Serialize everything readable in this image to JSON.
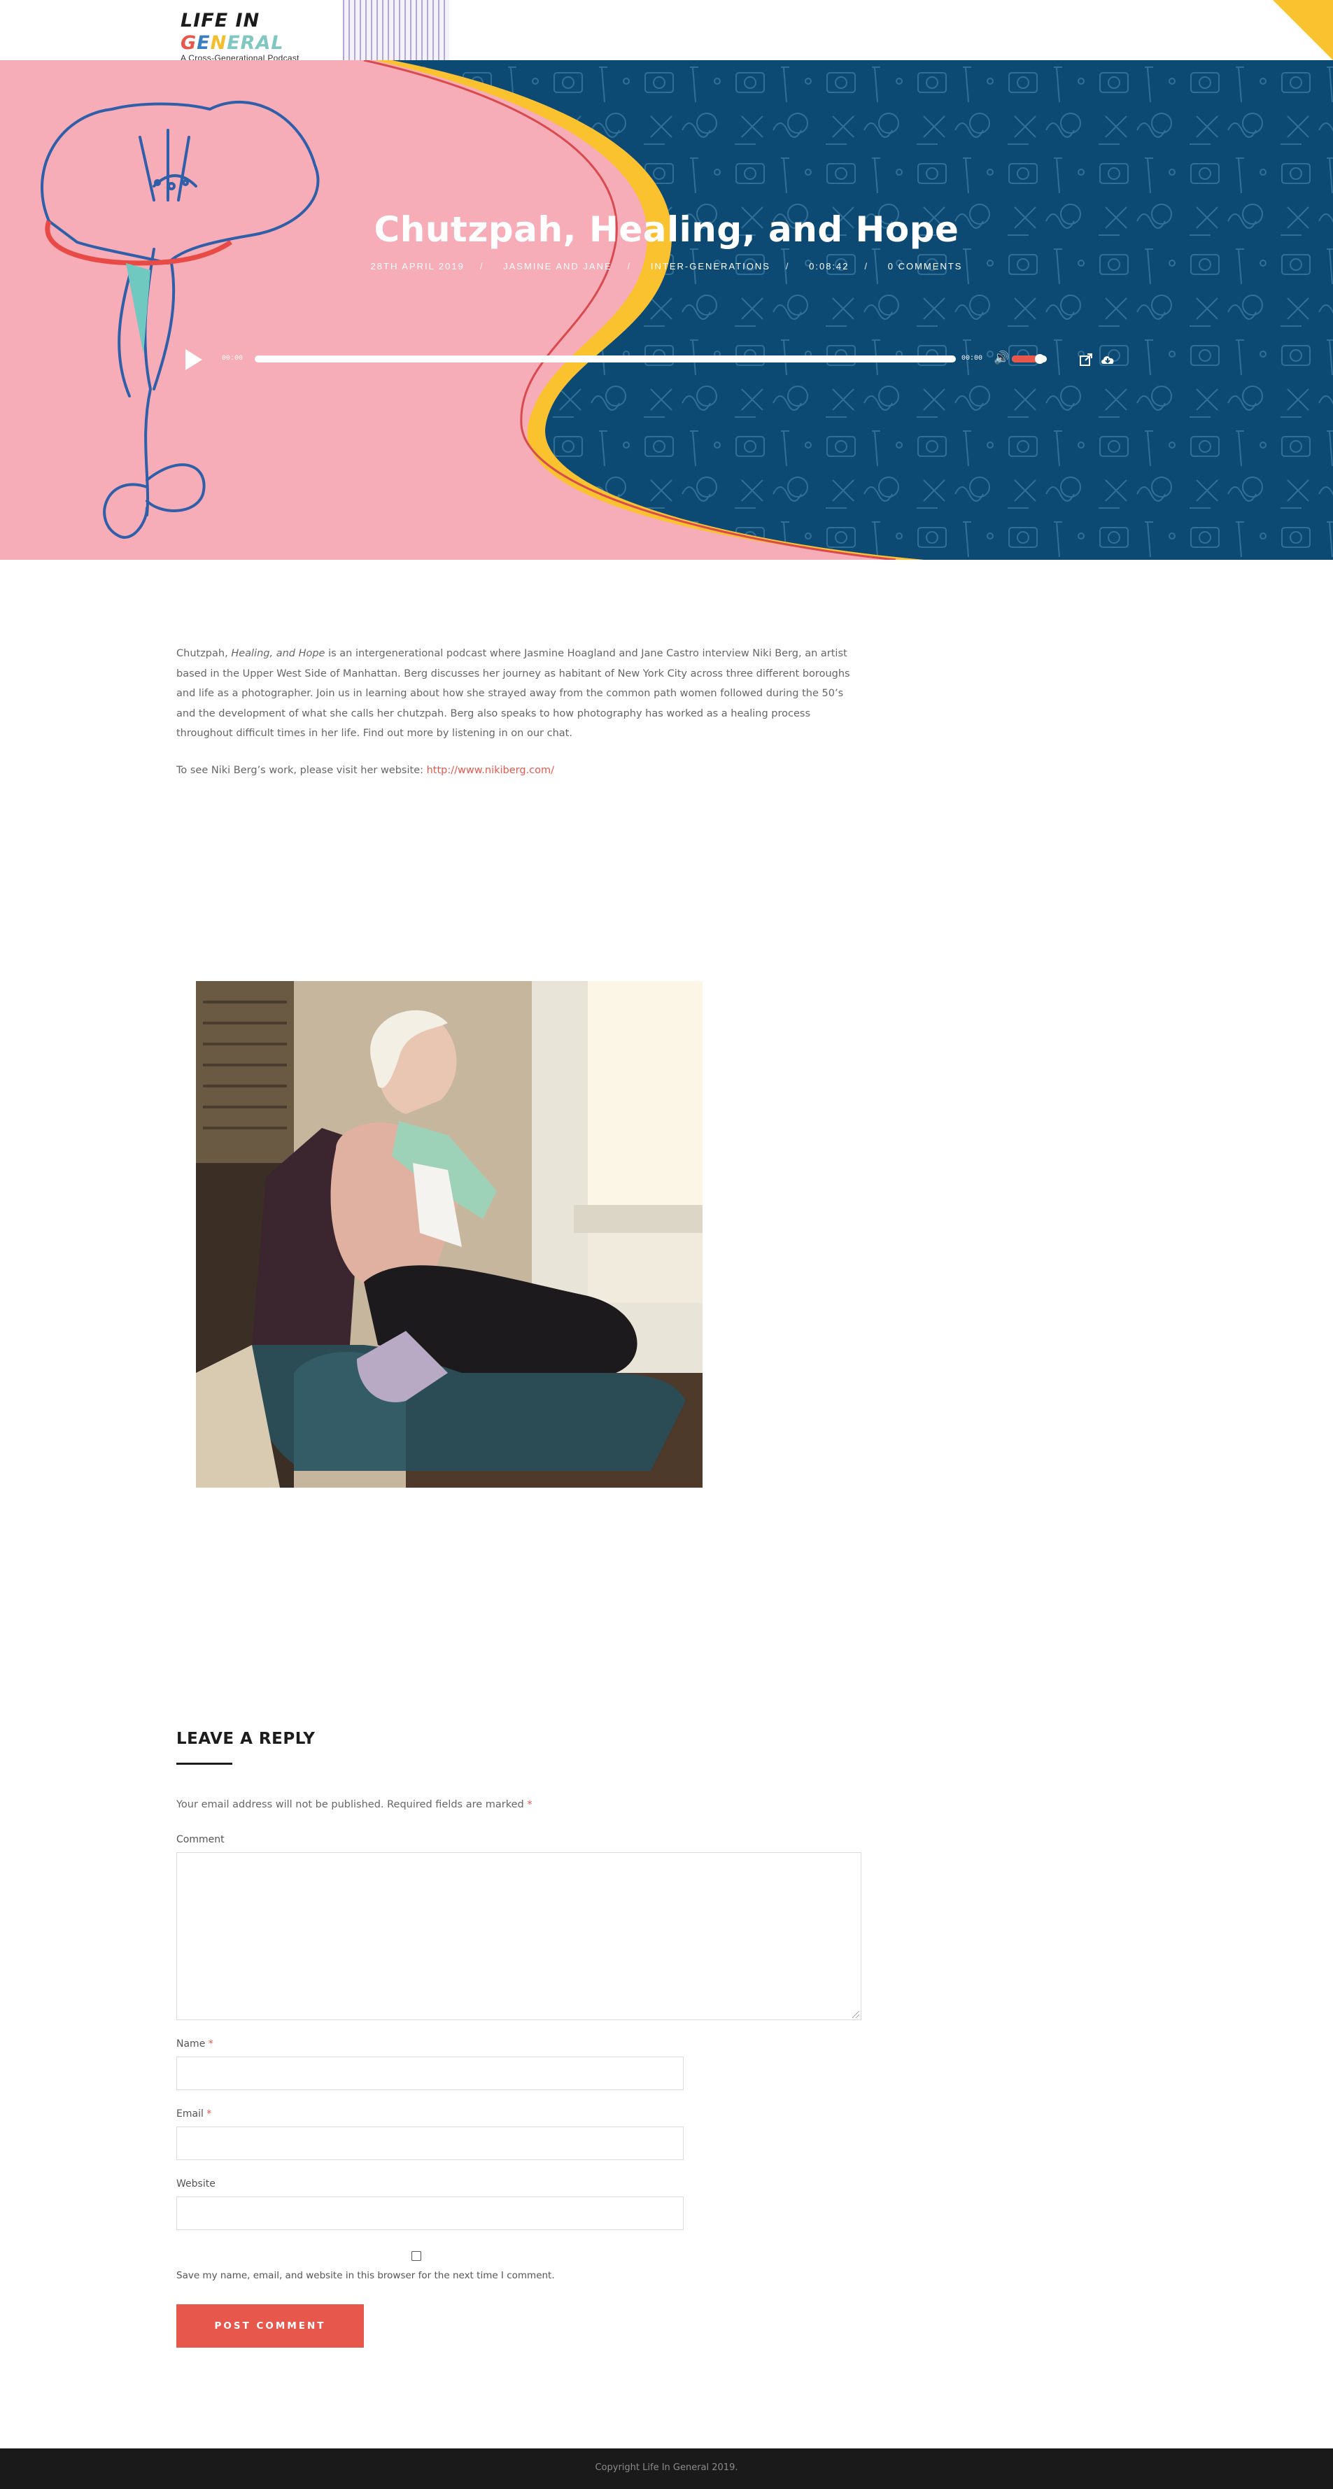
{
  "header": {
    "logo_title_part1": "LIFE IN ",
    "logo_title_g": "G",
    "logo_title_e": "E",
    "logo_title_n": "N",
    "logo_title_rest": "ERAL",
    "logo_subtitle": "A Cross-Generational Podcast"
  },
  "hero": {
    "title": "Chutzpah, Healing, and Hope",
    "meta": {
      "date": "28TH APRIL 2019",
      "author": "JASMINE AND JANE",
      "category": "INTER-GENERATIONS",
      "duration": "0:08:42",
      "comments": "0 COMMENTS",
      "separator": "/"
    }
  },
  "player": {
    "current_time": "00:00",
    "duration_time": "00:00",
    "volume_level": 0.8
  },
  "article": {
    "p1_start": "Chutzpah, ",
    "p1_em": "Healing, and Hope",
    "p1_rest": " is an intergenerational podcast where Jasmine Hoagland and Jane Castro interview Niki Berg, an artist based in the Upper West Side of Manhattan. Berg discusses her journey as habitant of New York City across three different boroughs and life as a photographer. Join us in learning about how she strayed away from the common path women followed during the 50’s and the development of what she calls her chutzpah. Berg also speaks to how photography has worked as a healing process throughout difficult times in her life. Find out more by listening in on our chat.",
    "p2_text": "To see Niki Berg’s work, please visit her website: ",
    "p2_link": "http://www.nikiberg.com/"
  },
  "reply": {
    "title": "LEAVE A REPLY",
    "notes": "Your email address will not be published. Required fields are marked ",
    "required_mark": "*",
    "comment_label": "Comment",
    "name_label": "Name ",
    "email_label": "Email ",
    "website_label": "Website",
    "save_info_label": "Save my name, email, and website in this browser for the next time I comment.",
    "submit_label": "POST COMMENT"
  },
  "footer": {
    "copyright": "Copyright Life In General 2019."
  },
  "colors": {
    "accent": "#e8574b",
    "hero_pink": "#f6adb7",
    "hero_navy": "#0d4a73",
    "yellow": "#f9c22e"
  }
}
